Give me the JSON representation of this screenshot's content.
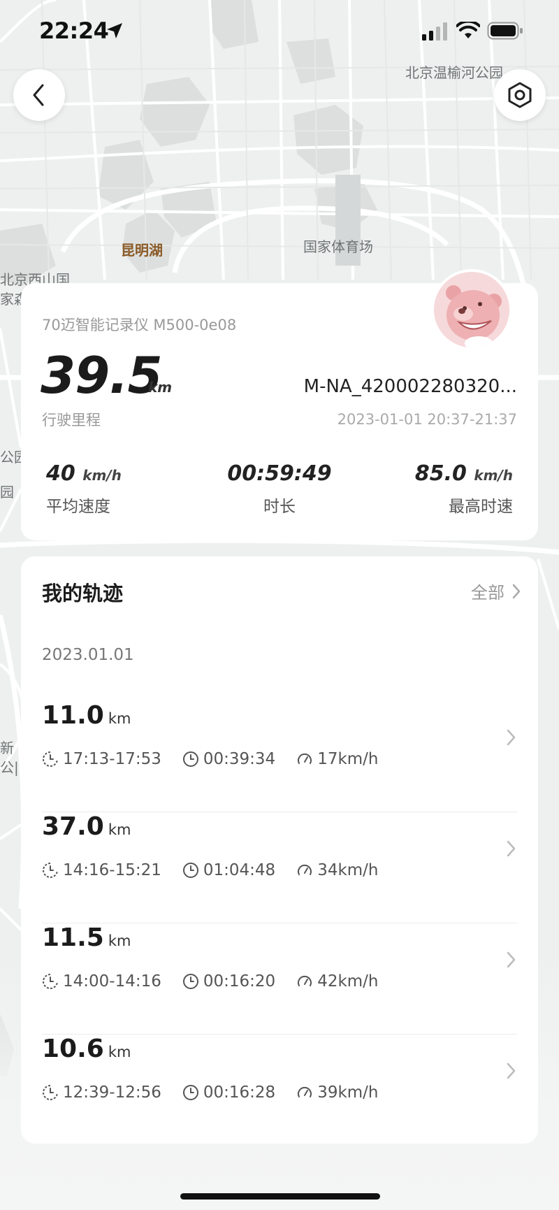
{
  "status_bar": {
    "time": "22:24",
    "icons": [
      "location-arrow-icon",
      "signal-icon",
      "wifi-icon",
      "battery-icon"
    ]
  },
  "map": {
    "labels": [
      {
        "text": "北京温榆河公园",
        "name": "map-label-wenyuhe"
      },
      {
        "text": "昆明湖",
        "name": "map-label-kunminghu"
      },
      {
        "text": "国家体育场",
        "name": "map-label-stadium"
      },
      {
        "text": "北京西山国",
        "name": "map-label-xishan"
      },
      {
        "text": "家森",
        "name": "map-label-jiasen"
      },
      {
        "text": "公园",
        "name": "map-label-gongyuan-1"
      },
      {
        "text": "园",
        "name": "map-label-gongyuan-2"
      },
      {
        "text": "新",
        "name": "map-label-xin"
      },
      {
        "text": "公|",
        "name": "map-label-gong"
      }
    ]
  },
  "nav": {
    "back_icon": "chevron-left-icon",
    "settings_icon": "hexagon-settings-icon"
  },
  "summary": {
    "device": "70迈智能记录仪 M500-0e08",
    "distance": "39.5",
    "distance_unit": "km",
    "distance_label": "行驶里程",
    "track_id": "M-NA_420002280320...",
    "time_range": "2023-01-01 20:37-21:37",
    "avg_speed": "40",
    "avg_speed_unit": "km/h",
    "avg_speed_label": "平均速度",
    "duration": "00:59:49",
    "duration_label": "时长",
    "max_speed": "85.0",
    "max_speed_unit": "km/h",
    "max_speed_label": "最高时速"
  },
  "tracks": {
    "title": "我的轨迹",
    "all_label": "全部",
    "date": "2023.01.01",
    "items": [
      {
        "distance": "11.0",
        "unit": "km",
        "time": "17:13-17:53",
        "duration": "00:39:34",
        "speed": "17km/h"
      },
      {
        "distance": "37.0",
        "unit": "km",
        "time": "14:16-15:21",
        "duration": "01:04:48",
        "speed": "34km/h"
      },
      {
        "distance": "11.5",
        "unit": "km",
        "time": "14:00-14:16",
        "duration": "00:16:20",
        "speed": "42km/h"
      },
      {
        "distance": "10.6",
        "unit": "km",
        "time": "12:39-12:56",
        "duration": "00:16:28",
        "speed": "39km/h"
      }
    ]
  },
  "colors": {
    "map_bg": "#eef0f0",
    "road": "#ffffff",
    "green": "#d8dcdb",
    "avatar_bg": "#f6d9db"
  }
}
